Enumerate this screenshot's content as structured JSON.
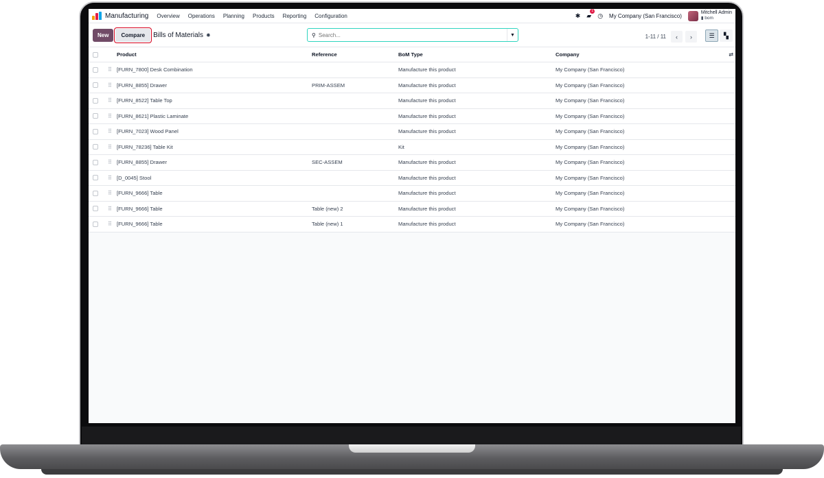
{
  "navbar": {
    "app_name": "Manufacturing",
    "menu": [
      "Overview",
      "Operations",
      "Planning",
      "Products",
      "Reporting",
      "Configuration"
    ],
    "message_count": "1",
    "company": "My Company (San Francisco)",
    "user_name": "Mitchell Admin",
    "database": "bom"
  },
  "control": {
    "new_label": "New",
    "compare_label": "Compare",
    "title": "Bills of Materials",
    "search_placeholder": "Search...",
    "pager": "1-11 / 11"
  },
  "table": {
    "columns": [
      "Product",
      "Reference",
      "BoM Type",
      "Company"
    ],
    "rows": [
      {
        "product": "[FURN_7800] Desk Combination",
        "reference": "",
        "bom_type": "Manufacture this product",
        "company": "My Company (San Francisco)"
      },
      {
        "product": "[FURN_8855] Drawer",
        "reference": "PRIM-ASSEM",
        "bom_type": "Manufacture this product",
        "company": "My Company (San Francisco)"
      },
      {
        "product": "[FURN_8522] Table Top",
        "reference": "",
        "bom_type": "Manufacture this product",
        "company": "My Company (San Francisco)"
      },
      {
        "product": "[FURN_8621] Plastic Laminate",
        "reference": "",
        "bom_type": "Manufacture this product",
        "company": "My Company (San Francisco)"
      },
      {
        "product": "[FURN_7023] Wood Panel",
        "reference": "",
        "bom_type": "Manufacture this product",
        "company": "My Company (San Francisco)"
      },
      {
        "product": "[FURN_78236] Table Kit",
        "reference": "",
        "bom_type": "Kit",
        "company": "My Company (San Francisco)"
      },
      {
        "product": "[FURN_8855] Drawer",
        "reference": "SEC-ASSEM",
        "bom_type": "Manufacture this product",
        "company": "My Company (San Francisco)"
      },
      {
        "product": "[D_0045] Stool",
        "reference": "",
        "bom_type": "Manufacture this product",
        "company": "My Company (San Francisco)"
      },
      {
        "product": "[FURN_9666] Table",
        "reference": "",
        "bom_type": "Manufacture this product",
        "company": "My Company (San Francisco)"
      },
      {
        "product": "[FURN_9666] Table",
        "reference": "Table (new) 2",
        "bom_type": "Manufacture this product",
        "company": "My Company (San Francisco)"
      },
      {
        "product": "[FURN_9666] Table",
        "reference": "Table (new) 1",
        "bom_type": "Manufacture this product",
        "company": "My Company (San Francisco)"
      }
    ]
  },
  "colors": {
    "brand": "#714b67",
    "highlight_outline": "#d6001c",
    "search_border": "#2dd4bf"
  }
}
